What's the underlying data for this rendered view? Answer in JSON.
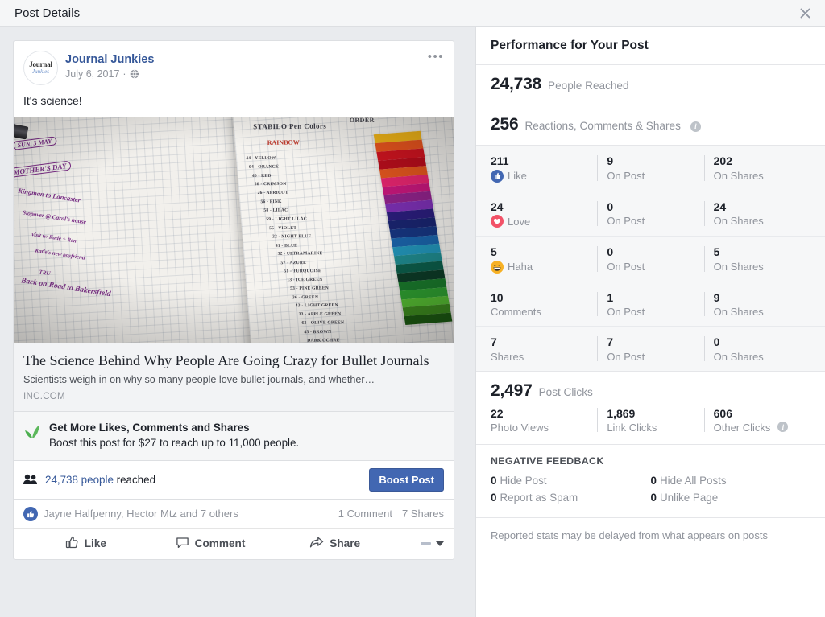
{
  "titlebar": {
    "title": "Post Details",
    "close_icon": "close-icon"
  },
  "post": {
    "page_name": "Journal Junkies",
    "avatar_top": "Journal",
    "avatar_bottom": "Junkies",
    "date": "July 6, 2017",
    "privacy_icon": "globe-icon",
    "separator": "·",
    "menu_icon": "ellipsis-icon",
    "message": "It's science!",
    "photo": {
      "alt": "Bullet journal open to a Stabilo pen color rainbow order page with purple handwriting",
      "left_page_lines": [
        "SUN, 3 MAY",
        "MOTHER'S DAY",
        "Kingman to Lancaster",
        "Stopover @ Carol's house",
        "visit w/ Katie + Ren",
        "Katie's new boyfriend",
        "TRU",
        "Back on Road to Bakersfield"
      ],
      "right_page_title": "STABILO Pen Colors",
      "right_page_subtitle": "RAINBOW",
      "right_page_title_end": "ORDER",
      "color_list": [
        "44 - YELLOW",
        "04 - ORANGE",
        "40 - RED",
        "50 - CRIMSON",
        "26 - APRICOT",
        "56 - PINK",
        "58 - LILAC",
        "59 - LIGHT LILAC",
        "55 - VIOLET",
        "22 - NIGHT BLUE",
        "41 - BLUE",
        "32 - ULTRAMARINE",
        "57 - AZURE",
        "51 - TURQUOISE",
        "13 - ICE GREEN",
        "53 - PINE GREEN",
        "36 - GREEN",
        "43 - LIGHT GREEN",
        "33 - APPLE GREEN",
        "63 - OLIVE GREEN",
        "45 - BROWN",
        "DARK OCHRE"
      ],
      "swatch_colors": [
        "#f0b418",
        "#e8541e",
        "#cf1420",
        "#b80d1c",
        "#e2561e",
        "#e3256e",
        "#c4177a",
        "#8e2288",
        "#7a2fb0",
        "#2a1d7a",
        "#19246e",
        "#16357f",
        "#1a63a8",
        "#2294b8",
        "#1f8a8e",
        "#0c5d4a",
        "#0d3b27",
        "#1a7a2c",
        "#2fa031",
        "#56bd33",
        "#3d8b1f",
        "#1c5a12"
      ]
    },
    "link": {
      "title": "The Science Behind Why People Are Going Crazy for Bullet Journals",
      "description": "Scientists weigh in on why so many people love bullet journals, and whether…",
      "domain": "INC.COM"
    },
    "boost": {
      "icon": "leaf-icon",
      "headline": "Get More Likes, Comments and Shares",
      "subline": "Boost this post for $27 to reach up to 11,000 people."
    },
    "reach": {
      "people_icon": "people-icon",
      "count": "24,738 people",
      "suffix": "reached",
      "button": "Boost Post"
    },
    "engagement": {
      "like_icon": "thumbs-up-badge-icon",
      "names": "Jayne Halfpenny, Hector Mtz and 7 others",
      "comments": "1 Comment",
      "shares": "7 Shares"
    },
    "actions": [
      {
        "label": "Like",
        "icon": "thumbs-up-icon"
      },
      {
        "label": "Comment",
        "icon": "comment-bubble-icon"
      },
      {
        "label": "Share",
        "icon": "share-arrow-icon"
      }
    ],
    "action_caret_icon": "chevron-down-icon"
  },
  "performance": {
    "title": "Performance for Your Post",
    "reach": {
      "value": "24,738",
      "label": "People Reached"
    },
    "engagement": {
      "value": "256",
      "label": "Reactions, Comments & Shares",
      "info_icon": "info-icon"
    },
    "breakdown": [
      {
        "icon": "like-reaction-icon",
        "icon_class": "ico-like",
        "total": "211",
        "label": "Like",
        "on_post": "9",
        "on_post_label": "On Post",
        "on_shares": "202",
        "on_shares_label": "On Shares"
      },
      {
        "icon": "love-reaction-icon",
        "icon_class": "ico-love",
        "total": "24",
        "label": "Love",
        "on_post": "0",
        "on_post_label": "On Post",
        "on_shares": "24",
        "on_shares_label": "On Shares"
      },
      {
        "icon": "haha-reaction-icon",
        "icon_class": "ico-haha",
        "total": "5",
        "label": "Haha",
        "on_post": "0",
        "on_post_label": "On Post",
        "on_shares": "5",
        "on_shares_label": "On Shares"
      },
      {
        "icon": null,
        "icon_class": "",
        "total": "10",
        "label": "Comments",
        "on_post": "1",
        "on_post_label": "On Post",
        "on_shares": "9",
        "on_shares_label": "On Shares"
      },
      {
        "icon": null,
        "icon_class": "",
        "total": "7",
        "label": "Shares",
        "on_post": "7",
        "on_post_label": "On Post",
        "on_shares": "0",
        "on_shares_label": "On Shares"
      }
    ],
    "clicks": {
      "value": "2,497",
      "label": "Post Clicks",
      "photo_views": "22",
      "photo_views_label": "Photo Views",
      "link_clicks": "1,869",
      "link_clicks_label": "Link Clicks",
      "other_clicks": "606",
      "other_clicks_label": "Other Clicks",
      "other_info_icon": "info-icon"
    },
    "negative_feedback": {
      "title": "NEGATIVE FEEDBACK",
      "items": [
        {
          "value": "0",
          "label": "Hide Post"
        },
        {
          "value": "0",
          "label": "Hide All Posts"
        },
        {
          "value": "0",
          "label": "Report as Spam"
        },
        {
          "value": "0",
          "label": "Unlike Page"
        }
      ]
    },
    "footnote": "Reported stats may be delayed from what appears on posts"
  },
  "colors": {
    "accent": "#4267b2",
    "link": "#365899",
    "muted": "#90949c",
    "text": "#1d2129",
    "panel_bg": "#f6f7f8",
    "page_bg": "#e9ebee"
  }
}
